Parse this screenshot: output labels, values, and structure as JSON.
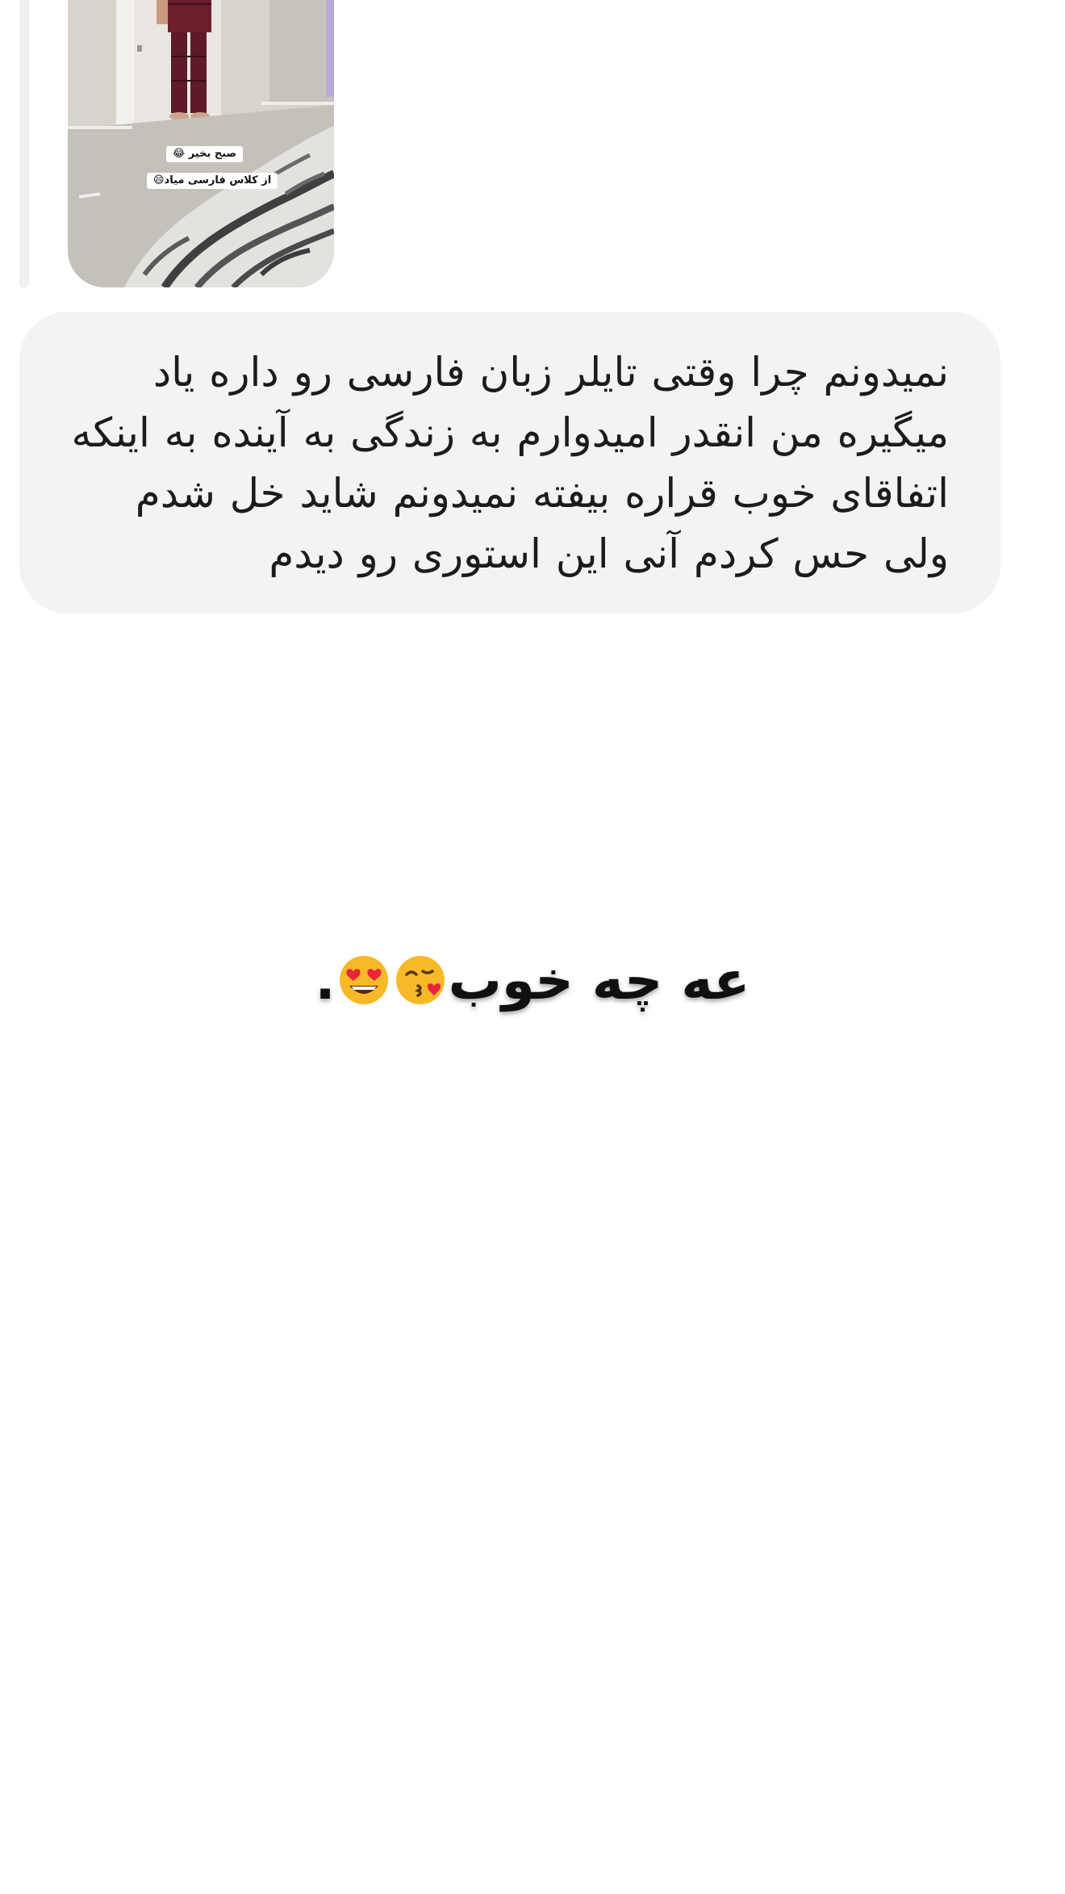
{
  "story": {
    "sticker_line_1": "صبح بخیر 😂",
    "sticker_line_2": "از کلاس فارسی میاد😄"
  },
  "message": {
    "text": "نمیدونم چرا وقتی تایلر زبان فارسی رو داره یاد میگیره من انقدر امیدوارم به زندگی به آینده به اینکه اتفاقای خوب قراره بیفته نمیدونم شاید خل شدم ولی حس کردم آنی این استوری رو دیدم"
  },
  "caption": {
    "text": "عه چه خوب",
    "emojis": [
      "kissing-heart-emoji",
      "heart-eyes-emoji"
    ],
    "trailing": "."
  },
  "colors": {
    "bubble_bg": "#f2f3f5",
    "reply_bar": "#f0f0f2",
    "text": "#1b1b1b"
  }
}
